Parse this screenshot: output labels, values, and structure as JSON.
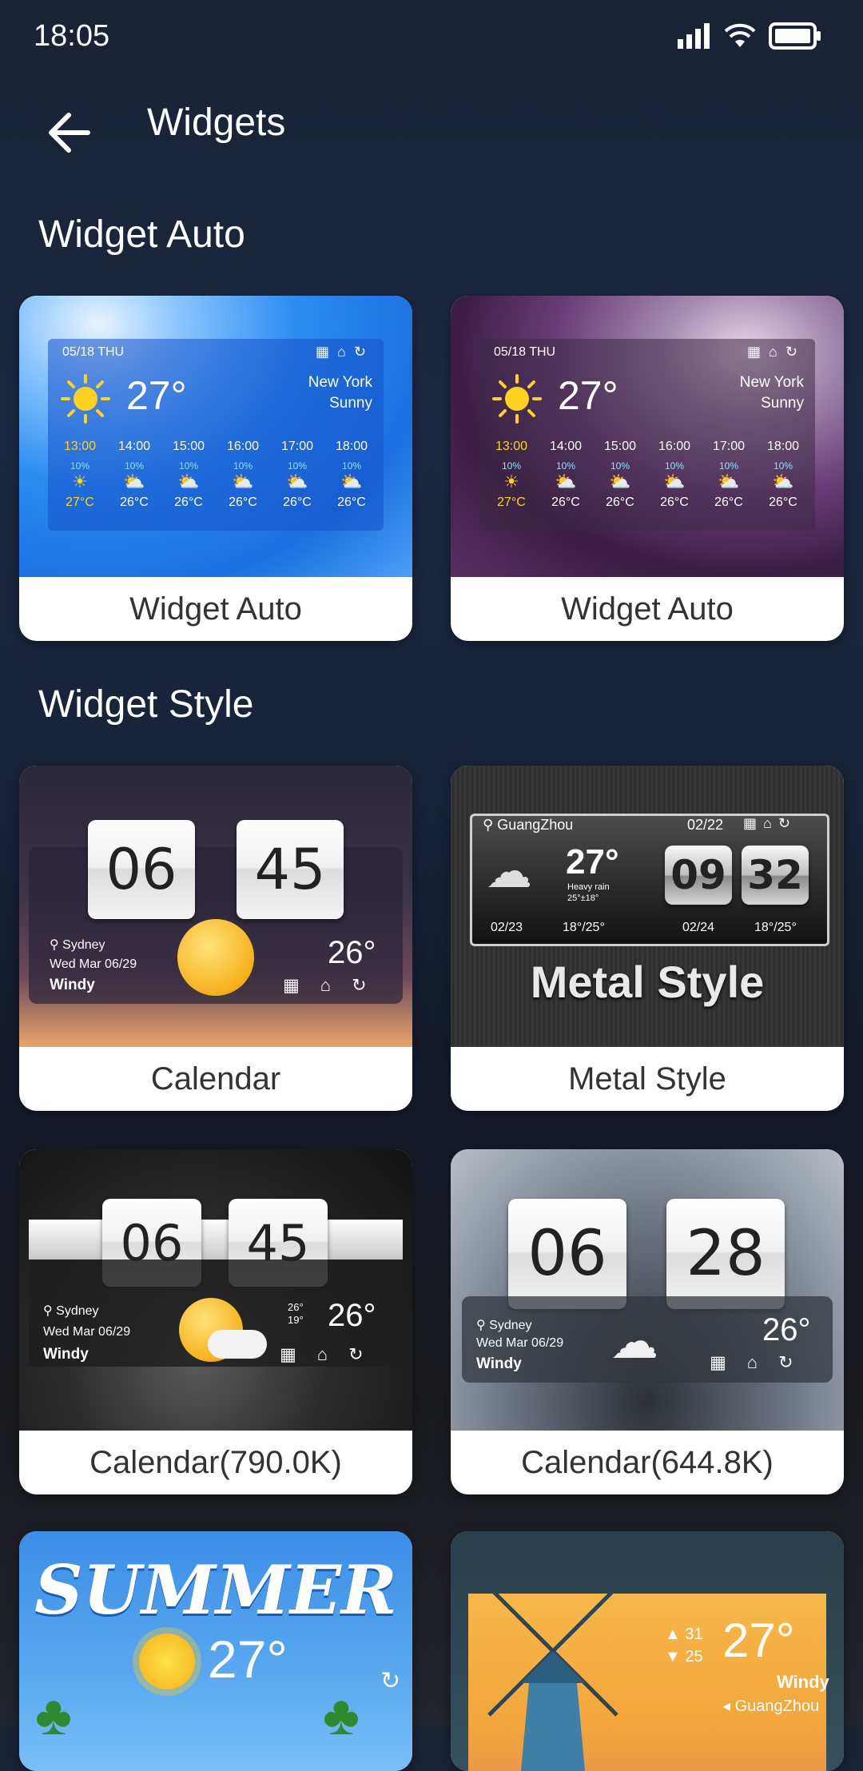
{
  "status": {
    "time": "18:05"
  },
  "header": {
    "title": "Widgets"
  },
  "sections": {
    "auto": {
      "title": "Widget Auto"
    },
    "style": {
      "title": "Widget Style"
    }
  },
  "cards": {
    "auto_blue": {
      "label": "Widget Auto",
      "date": "05/18 THU",
      "temp": "27°",
      "city": "New York",
      "cond": "Sunny",
      "hours": [
        "13:00",
        "14:00",
        "15:00",
        "16:00",
        "17:00",
        "18:00"
      ],
      "pop": [
        "10%",
        "10%",
        "10%",
        "10%",
        "10%",
        "10%"
      ],
      "temps": [
        "27°C",
        "26°C",
        "26°C",
        "26°C",
        "26°C",
        "26°C"
      ]
    },
    "auto_purple": {
      "label": "Widget Auto",
      "date": "05/18 THU",
      "temp": "27°",
      "city": "New York",
      "cond": "Sunny",
      "hours": [
        "13:00",
        "14:00",
        "15:00",
        "16:00",
        "17:00",
        "18:00"
      ],
      "pop": [
        "10%",
        "10%",
        "10%",
        "10%",
        "10%",
        "10%"
      ],
      "temps": [
        "27°C",
        "26°C",
        "26°C",
        "26°C",
        "26°C",
        "26°C"
      ]
    },
    "calendar": {
      "label": "Calendar",
      "hour": "06",
      "minute": "45",
      "city": "Sydney",
      "date": "Wed Mar 06/29",
      "cond": "Windy",
      "temp": "26°"
    },
    "metal": {
      "label": "Metal Style",
      "city": "GuangZhou",
      "date": "02/22",
      "temp": "27°",
      "cond": "Heavy rain",
      "range": "25°±18°",
      "hour": "09",
      "minute": "32",
      "fc1_date": "02/23",
      "fc1_range": "18°/25°",
      "fc2_date": "02/24",
      "fc2_range": "18°/25°",
      "banner": "Metal Style"
    },
    "cal790": {
      "label": "Calendar(790.0K)",
      "hour": "06",
      "minute": "45",
      "city": "Sydney",
      "date": "Wed Mar 06/29",
      "cond": "Windy",
      "hi": "26°",
      "lo": "19°",
      "temp": "26°"
    },
    "cal644": {
      "label": "Calendar(644.8K)",
      "hour": "06",
      "minute": "28",
      "city": "Sydney",
      "date": "Wed Mar 06/29",
      "cond": "Windy",
      "temp": "26°"
    },
    "summer": {
      "title": "SUMMER",
      "temp": "27°"
    },
    "windmill": {
      "hi": "31",
      "lo": "25",
      "temp": "27°",
      "cond": "Windy",
      "city": "GuangZhou"
    }
  },
  "colors": {
    "accent_sun": "#ffd21f",
    "bg": "#1a2236",
    "hour_highlight": "#ffd21f"
  }
}
